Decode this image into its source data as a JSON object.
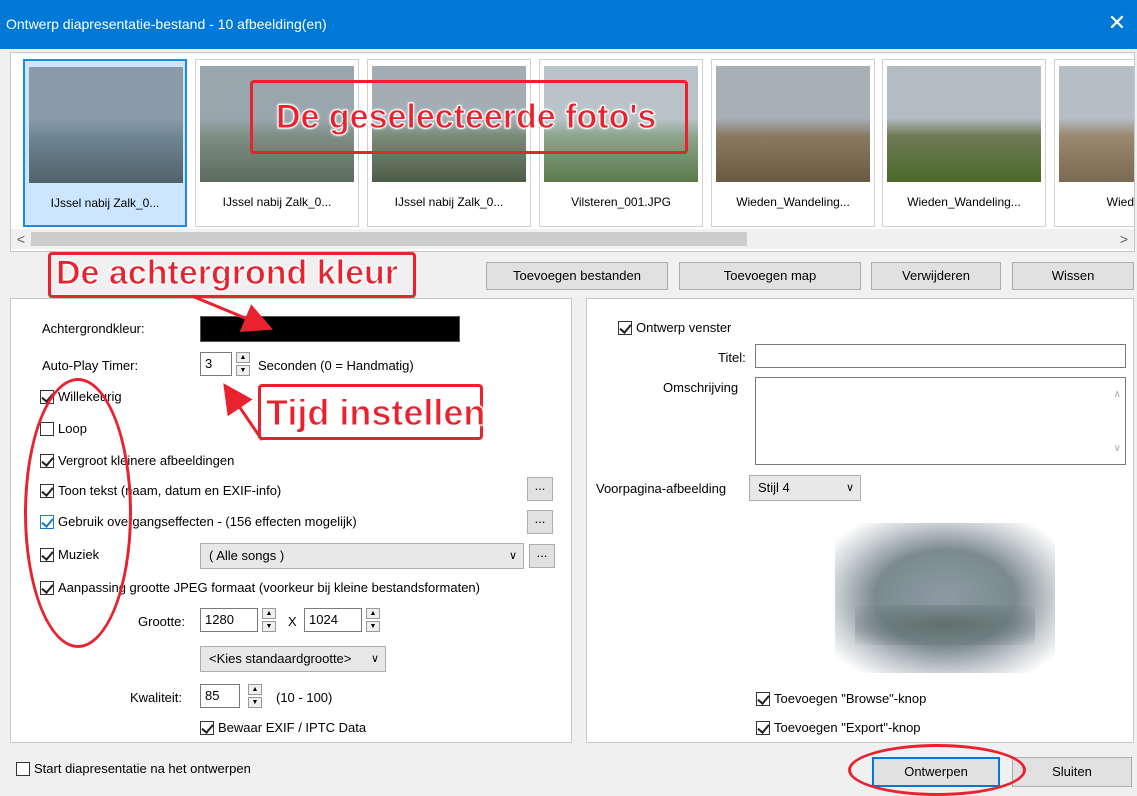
{
  "window": {
    "title": "Ontwerp diapresentatie-bestand - 10 afbeelding(en)",
    "close": "✕"
  },
  "thumbnails": [
    {
      "caption": "IJssel nabij Zalk_0...",
      "colors": [
        "#8a9aa8",
        "#6e8592",
        "#52626a"
      ]
    },
    {
      "caption": "IJssel nabij Zalk_0...",
      "colors": [
        "#9aa6ae",
        "#7f8f85",
        "#5c6b5a"
      ]
    },
    {
      "caption": "IJssel nabij Zalk_0...",
      "colors": [
        "#a3adb3",
        "#7a8c78",
        "#4d5c47"
      ]
    },
    {
      "caption": "Vilsteren_001.JPG",
      "colors": [
        "#b9c4ca",
        "#8ea58d",
        "#5a7a4a"
      ]
    },
    {
      "caption": "Wieden_Wandeling...",
      "colors": [
        "#a7b0b6",
        "#8a7a62",
        "#6b5a42"
      ]
    },
    {
      "caption": "Wieden_Wandeling...",
      "colors": [
        "#b3bcc2",
        "#6f7a55",
        "#4a6a2a"
      ]
    },
    {
      "caption": "Wieden_W",
      "colors": [
        "#b5bec4",
        "#9a8870",
        "#7a6a52"
      ]
    }
  ],
  "scroll": {
    "left": "<",
    "right": ">"
  },
  "buttons": {
    "add_files": "Toevoegen bestanden",
    "add_folder": "Toevoegen map",
    "remove": "Verwijderen",
    "clear": "Wissen",
    "design": "Ontwerpen",
    "close": "Sluiten",
    "dots": "..."
  },
  "left": {
    "bg_label": "Achtergrondkleur:",
    "bg_color": "#000000",
    "timer_label": "Auto-Play Timer:",
    "timer_value": "3",
    "timer_hint": "Seconden (0 = Handmatig)",
    "random": "Willekeurig",
    "loop": "Loop",
    "enlarge": "Vergroot kleinere afbeeldingen",
    "show_text": "Toon tekst (naam, datum en EXIF-info)",
    "transitions": "Gebruik overgangseffecten - (156 effecten mogelijk)",
    "music": "Muziek",
    "music_value": "( Alle songs )",
    "jpeg": "Aanpassing grootte JPEG formaat (voorkeur bij kleine bestandsformaten)",
    "size_label": "Grootte:",
    "width": "1280",
    "x": "X",
    "height": "1024",
    "size_preset": "<Kies standaardgrootte>",
    "quality_label": "Kwaliteit:",
    "quality": "85",
    "quality_range": "(10 - 100)",
    "exif": "Bewaar EXIF / IPTC Data"
  },
  "right": {
    "design_window": "Ontwerp venster",
    "title_label": "Titel:",
    "title_value": "",
    "desc_label": "Omschrijving",
    "front_label": "Voorpagina-afbeelding",
    "front_value": "Stijl 4",
    "browse": "Toevoegen \"Browse\"-knop",
    "export": "Toevoegen \"Export\"-knop"
  },
  "start_after": "Start diapresentatie na het ontwerpen",
  "annotations": {
    "selected_photos": "De geselecteerde foto's",
    "background_color": "De achtergrond kleur",
    "set_time": "Tijd instellen"
  },
  "accent": "#0078d7",
  "annotation_color": "#e8232f"
}
